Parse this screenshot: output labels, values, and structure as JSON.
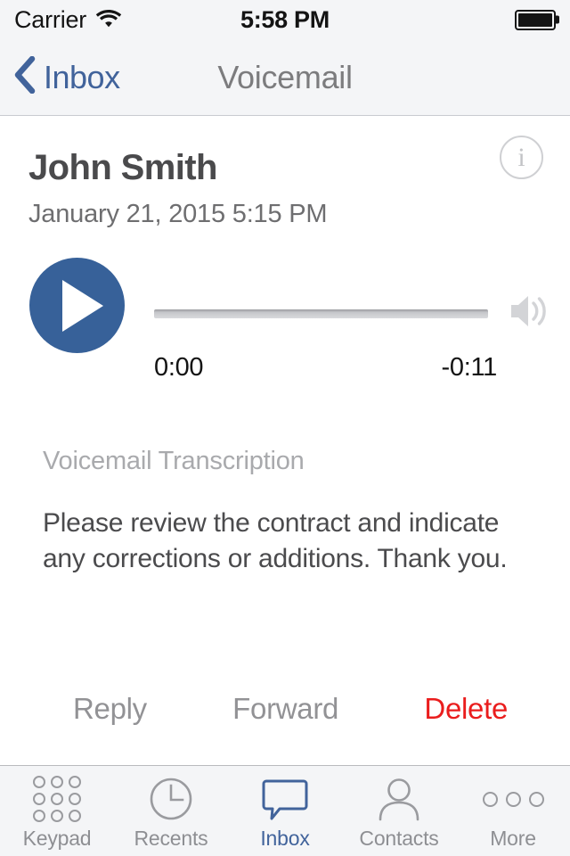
{
  "status_bar": {
    "carrier": "Carrier",
    "wifi_icon": "wifi-icon",
    "time": "5:58 PM",
    "battery_icon": "battery-full-icon"
  },
  "nav_bar": {
    "back_icon": "chevron-left-icon",
    "back_label": "Inbox",
    "title": "Voicemail"
  },
  "message": {
    "sender_name": "John Smith",
    "timestamp": "January 21, 2015 5:15 PM",
    "info_icon": "info-icon",
    "info_glyph": "i"
  },
  "player": {
    "play_icon": "play-icon",
    "speaker_icon": "speaker-icon",
    "elapsed_time": "0:00",
    "remaining_time": "-0:11",
    "progress_percent": 0,
    "accent_color": "#376199"
  },
  "transcription": {
    "heading": "Voicemail Transcription",
    "body": "Please review the contract and indicate any corrections or additions. Thank you."
  },
  "actions": {
    "reply_label": "Reply",
    "forward_label": "Forward",
    "delete_label": "Delete",
    "delete_color": "#ea1d1d"
  },
  "tab_bar": {
    "active_index": 2,
    "active_color": "#41639b",
    "inactive_color": "#8e8f93",
    "tabs": [
      {
        "label": "Keypad",
        "icon": "keypad-icon"
      },
      {
        "label": "Recents",
        "icon": "clock-icon"
      },
      {
        "label": "Inbox",
        "icon": "speech-bubble-icon"
      },
      {
        "label": "Contacts",
        "icon": "person-icon"
      },
      {
        "label": "More",
        "icon": "ellipsis-icon"
      }
    ]
  }
}
